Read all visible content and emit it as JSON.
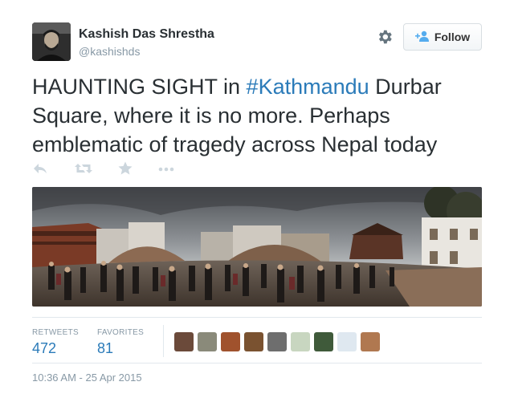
{
  "author": {
    "name": "Kashish Das Shrestha",
    "handle": "@kashishds"
  },
  "follow_button": {
    "label": "Follow"
  },
  "tweet": {
    "text_before": "HAUNTING SIGHT in ",
    "hashtag": "#Kathmandu",
    "text_after": " Durbar Square, where it is no more. Perhaps emblematic of tragedy across Nepal today"
  },
  "actions": {
    "icons": [
      "reply-icon",
      "retweet-icon",
      "favorite-icon",
      "more-icon"
    ]
  },
  "stats": {
    "retweets_label": "RETWEETS",
    "retweets_count": "472",
    "favorites_label": "FAVORITES",
    "favorites_count": "81"
  },
  "favoriters": {
    "count": 9,
    "colors": [
      "#6b4a3a",
      "#8a8a7a",
      "#a0522d",
      "#7a5230",
      "#6e6e6e",
      "#c8d6c0",
      "#3f5a3a",
      "#dfe8f0",
      "#b07850"
    ]
  },
  "timestamp": "10:36 AM - 25 Apr 2015",
  "colors": {
    "hashtag": "#2b7bb9",
    "secondary_text": "#8899a6",
    "stat_value": "#2b7bb9"
  }
}
